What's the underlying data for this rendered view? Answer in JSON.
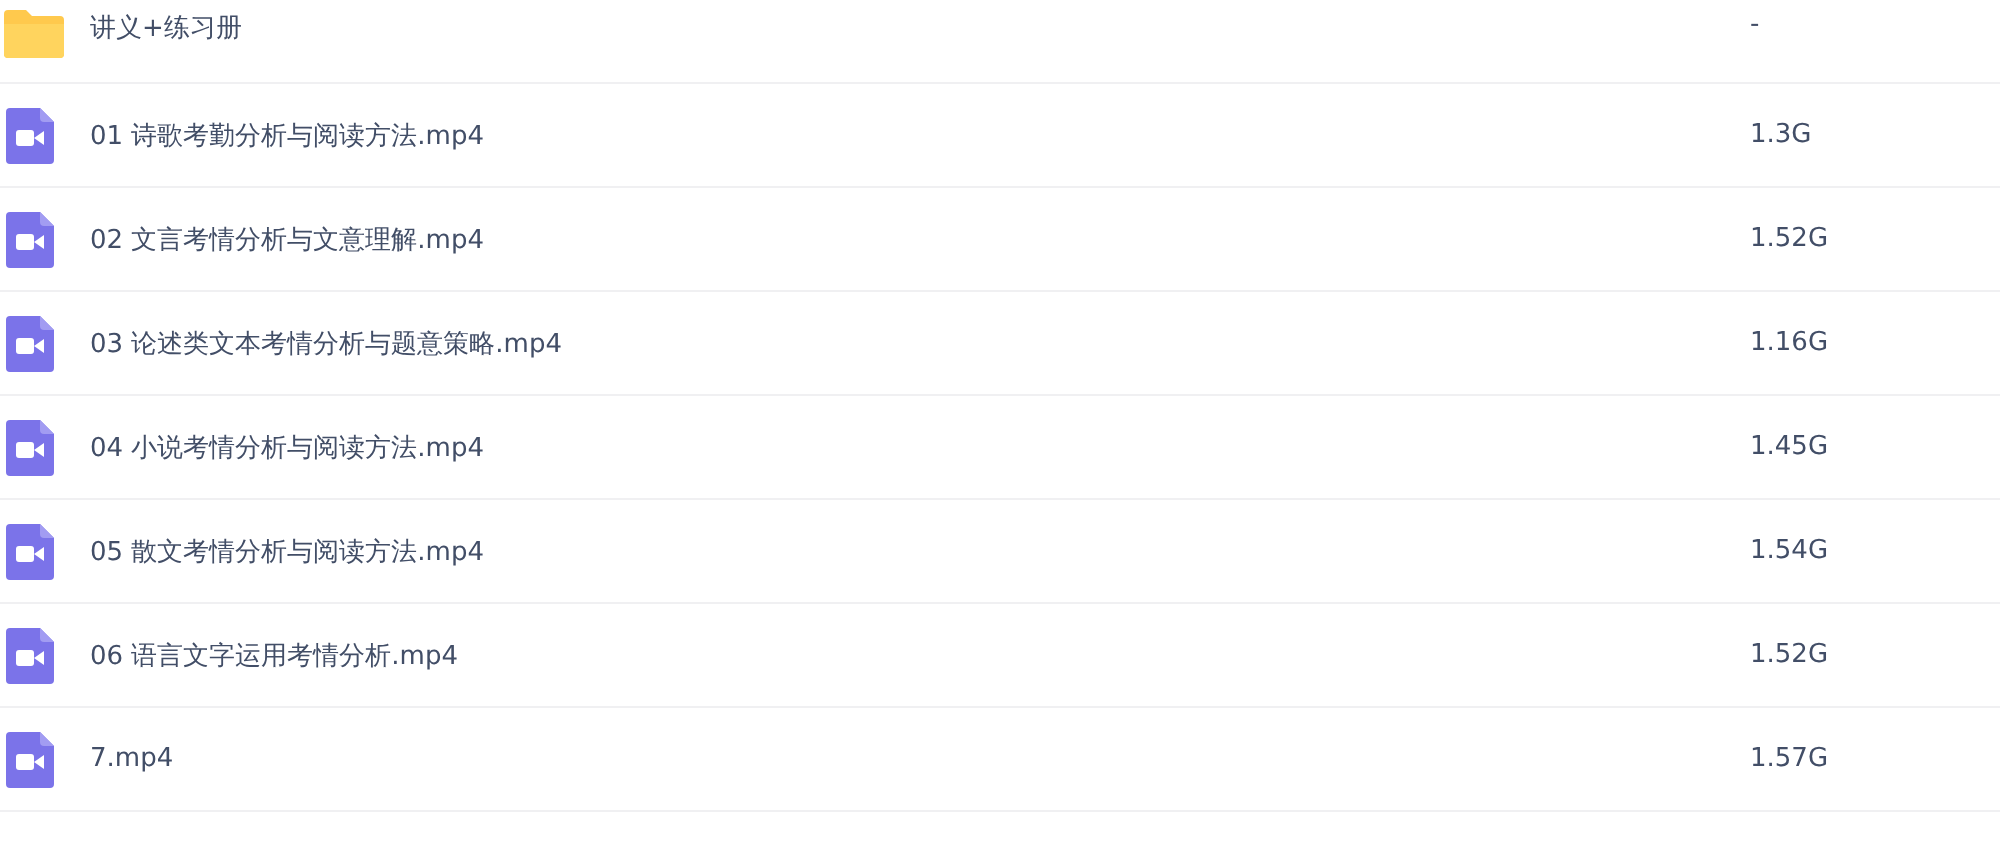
{
  "files": [
    {
      "kind": "folder",
      "name": "讲义+练习册",
      "size": "-"
    },
    {
      "kind": "video",
      "name": "01 诗歌考勤分析与阅读方法.mp4",
      "size": "1.3G"
    },
    {
      "kind": "video",
      "name": "02 文言考情分析与文意理解.mp4",
      "size": "1.52G"
    },
    {
      "kind": "video",
      "name": "03 论述类文本考情分析与题意策略.mp4",
      "size": "1.16G"
    },
    {
      "kind": "video",
      "name": "04 小说考情分析与阅读方法.mp4",
      "size": "1.45G"
    },
    {
      "kind": "video",
      "name": "05 散文考情分析与阅读方法.mp4",
      "size": "1.54G"
    },
    {
      "kind": "video",
      "name": "06 语言文字运用考情分析.mp4",
      "size": "1.52G"
    },
    {
      "kind": "video",
      "name": "7.mp4",
      "size": "1.57G"
    }
  ]
}
